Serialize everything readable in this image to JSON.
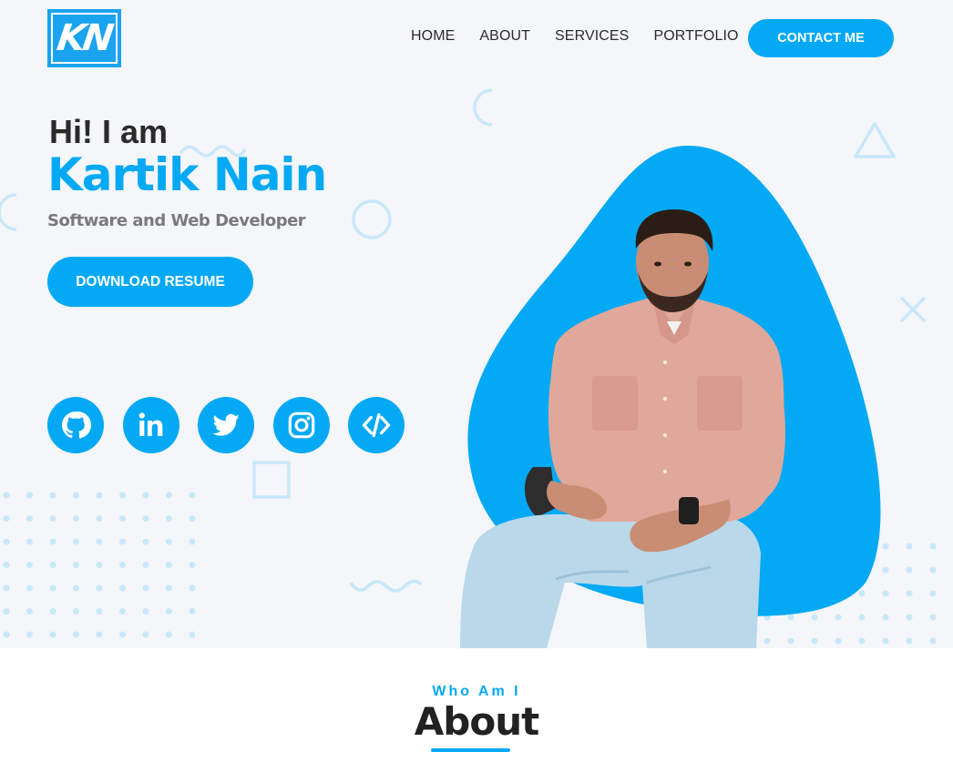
{
  "logo": {
    "text": "KN"
  },
  "nav": {
    "items": [
      "HOME",
      "ABOUT",
      "SERVICES",
      "PORTFOLIO"
    ],
    "contact_label": "CONTACT ME"
  },
  "hero": {
    "greeting": "Hi! I am",
    "name": "Kartik Nain",
    "role": "Software and Web Developer",
    "resume_label": "DOWNLOAD RESUME",
    "socials": [
      "github-icon",
      "linkedin-icon",
      "twitter-icon",
      "instagram-icon",
      "code-icon"
    ]
  },
  "about": {
    "kicker": "Who Am I",
    "title": "About"
  },
  "colors": {
    "accent": "#03a9f4",
    "background": "#f5f6fa",
    "text": "#222222",
    "muted": "#7a7a7a"
  }
}
